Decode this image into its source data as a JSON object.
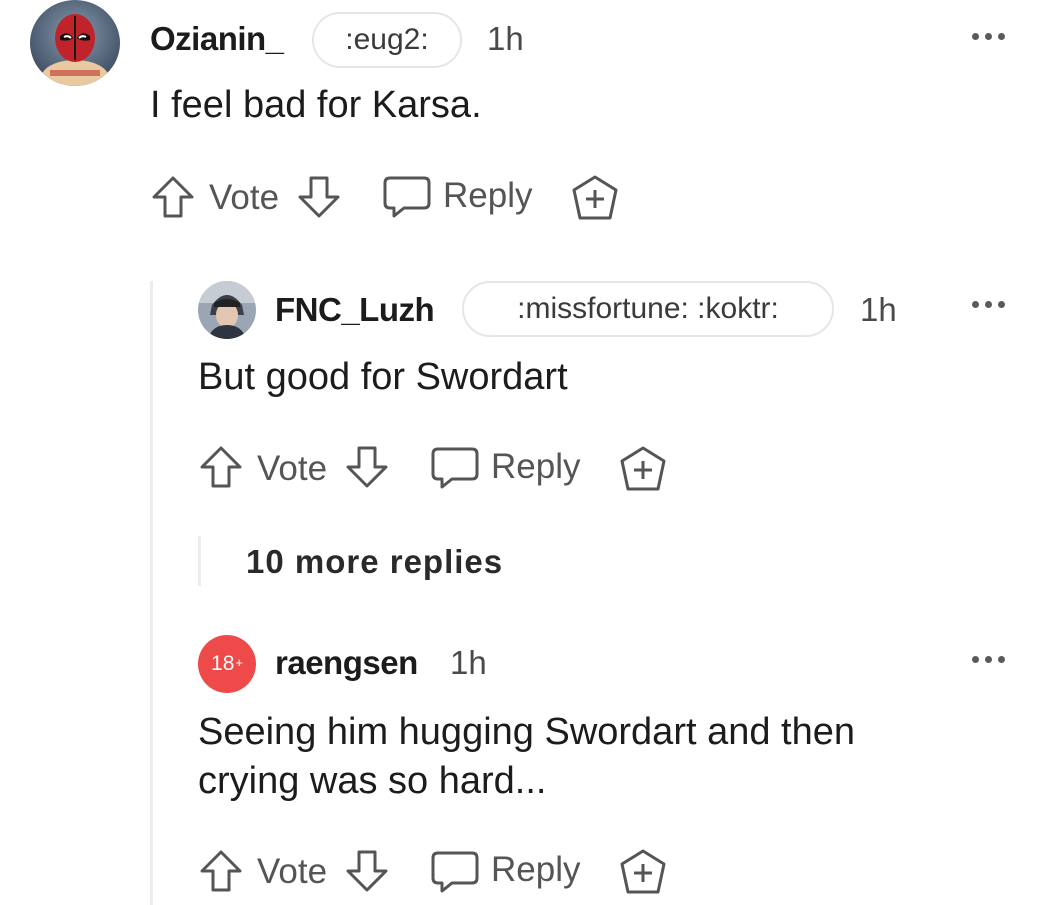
{
  "comments": [
    {
      "username": "Ozianin_",
      "flair": ":eug2:",
      "time": "1h",
      "body": "I feel bad for Karsa.",
      "vote_label": "Vote",
      "reply_label": "Reply",
      "avatar_icon": "deadpool-avatar"
    },
    {
      "username": "FNC_Luzh",
      "flair": ":missfortune: :koktr:",
      "time": "1h",
      "body": "But good for Swordart",
      "vote_label": "Vote",
      "reply_label": "Reply",
      "avatar_icon": "user-photo-avatar"
    },
    {
      "username": "raengsen",
      "avatar_badge": "18",
      "avatar_badge_plus": "+",
      "time": "1h",
      "body_line1": "Seeing him hugging Swordart and then",
      "body_line2": "crying was so hard...",
      "vote_label": "Vote",
      "reply_label": "Reply"
    }
  ],
  "more_replies": "10 more replies",
  "colors": {
    "nsfw_badge": "#ee4a4a",
    "thread_line": "#ececec",
    "icon_stroke": "#555555"
  }
}
